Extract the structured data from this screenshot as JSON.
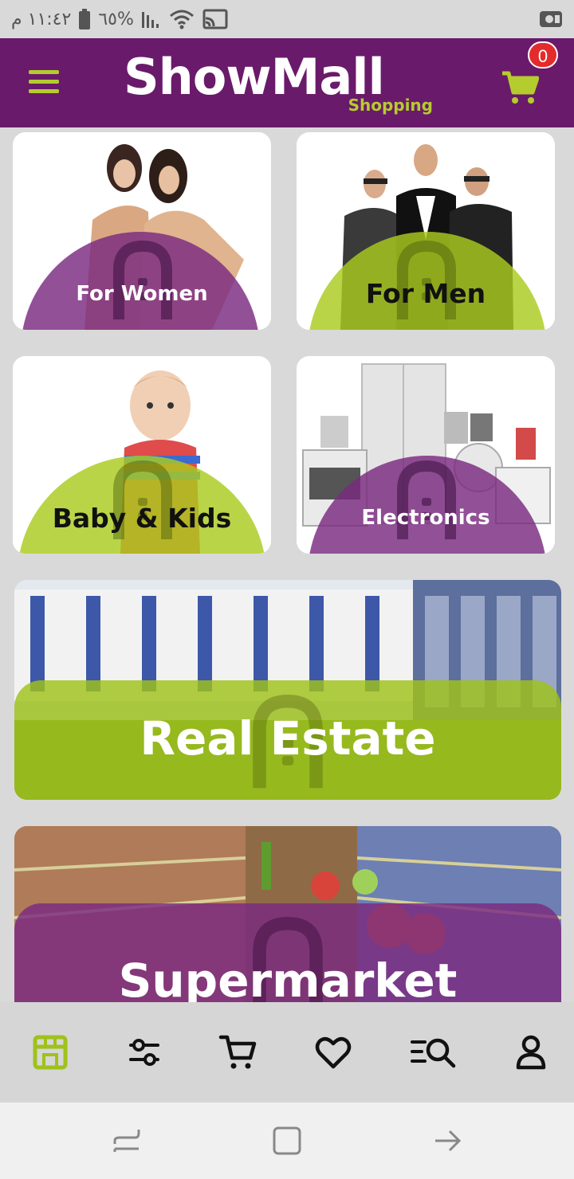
{
  "status_bar": {
    "time": "١١:٤٢ م",
    "battery": "%٦٥",
    "icons": [
      "battery-icon",
      "signal-icon",
      "wifi-icon",
      "cast-icon",
      "video-camera-icon"
    ]
  },
  "header": {
    "logo_main": "ShowMall",
    "logo_sub": "Shopping",
    "cart_count": "0",
    "brand_purple": "#6a1a6a",
    "brand_green": "#b5cc2e"
  },
  "categories": [
    {
      "label": "For Women",
      "dome_color": "#7a2a80"
    },
    {
      "label": "For Men",
      "dome_color": "#aacc1e"
    },
    {
      "label": "Baby & Kids",
      "dome_color": "#aacc1e"
    },
    {
      "label": "Electronics",
      "dome_color": "#7a2a80"
    },
    {
      "label": "Real Estate",
      "dome_color": "#9fc21a"
    },
    {
      "label": "Supermarket",
      "dome_color": "#7a2a80"
    }
  ],
  "bottom_nav": [
    "store-icon",
    "filters-icon",
    "cart-icon",
    "heart-icon",
    "search-list-icon",
    "profile-icon"
  ],
  "system_nav": [
    "recents-icon",
    "home-icon",
    "back-icon"
  ]
}
